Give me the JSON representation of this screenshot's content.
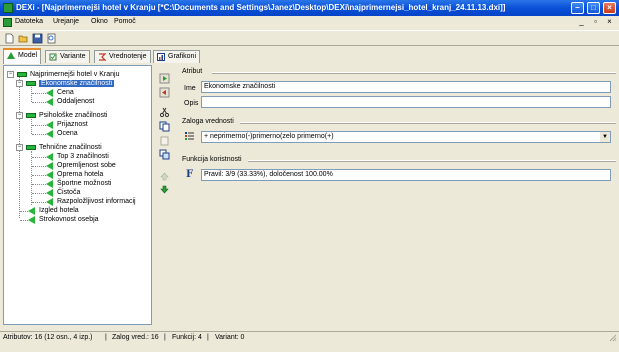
{
  "window": {
    "title": "DEXi - [Najprimernejši hotel v Kranju [*C:\\Documents and Settings\\Janez\\Desktop\\DEXi\\najprimernejsi_hotel_kranj_24.11.13.dxi]]",
    "app_icon": "dexi-app-icon",
    "buttons": [
      "minimize",
      "maximize",
      "close"
    ]
  },
  "menu": {
    "items": [
      "Datoteka",
      "Urejanje",
      "Okno",
      "Pomoč"
    ]
  },
  "toolbar": {
    "buttons": [
      "new-file-icon",
      "open-folder-icon",
      "save-icon",
      "print-preview-icon"
    ]
  },
  "tabs": [
    {
      "label": "Model",
      "icon": "model-icon",
      "active": true
    },
    {
      "label": "Variante",
      "icon": "variants-icon",
      "active": false
    },
    {
      "label": "Vrednotenje",
      "icon": "evaluation-icon",
      "active": false
    },
    {
      "label": "Grafikoni",
      "icon": "charts-icon",
      "active": false
    }
  ],
  "tree": {
    "root": "Najprimernejši hotel v Kranju",
    "nodes": [
      {
        "label": "Ekonomske značilnosti",
        "selected": true
      },
      {
        "label": "Cena"
      },
      {
        "label": "Oddaljenost"
      },
      {
        "label": "Psihološke značilnosti"
      },
      {
        "label": "Prijaznost"
      },
      {
        "label": "Ocena"
      },
      {
        "label": "Tehnične značilnosti"
      },
      {
        "label": "Top 3 značilnosti"
      },
      {
        "label": "Opremljenost sobe"
      },
      {
        "label": "Oprema hotela"
      },
      {
        "label": "Športne možnosti"
      },
      {
        "label": "Čistoča"
      },
      {
        "label": "Razpoložljivost informacij"
      },
      {
        "label": "Izgled hotela"
      },
      {
        "label": "Strokovnost osebja"
      }
    ]
  },
  "editor_buttons": [
    "add-attribute-icon",
    "delete-attribute-icon",
    "cut-icon",
    "copy-icon",
    "paste-icon",
    "duplicate-icon",
    "move-up-icon",
    "move-down-icon"
  ],
  "attribute": {
    "group_label": "Atribut",
    "name_label": "Ime",
    "name_value": "Ekonomske značilnosti",
    "desc_label": "Opis",
    "desc_value": ""
  },
  "scale": {
    "group_label": "Zaloga vrednosti",
    "value": "+ neprimerno(-)primerno(zelo primerno(+)"
  },
  "function": {
    "group_label": "Funkcija koristnosti",
    "value": "Pravil: 3/9 (33.33%), določenost 100.00%"
  },
  "status": {
    "attributes": "Atributov: 16 (12 osn., 4 izp.)",
    "scales": "Zalog vred.: 16",
    "functions": "Funkcij: 4",
    "variants": "Variant: 0"
  },
  "colors": {
    "titlebar": "#0a51d8",
    "selection": "#316ac5",
    "tree_icon": "#28b33b",
    "tab_accent": "#e68b2c"
  }
}
